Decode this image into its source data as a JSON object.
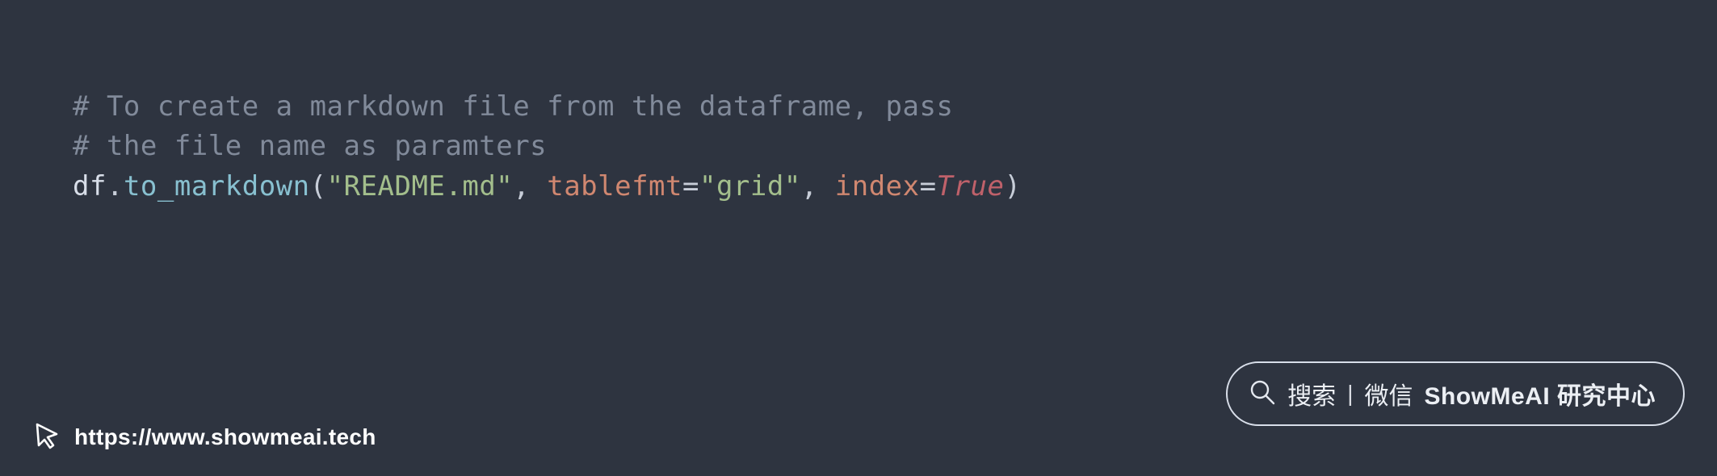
{
  "code": {
    "comment_line_1": "# To create a markdown file from the dataframe, pass",
    "comment_line_2": "# the file name as paramters",
    "obj": "df",
    "dot": ".",
    "method": "to_markdown",
    "open_paren": "(",
    "arg1_string": "\"README.md\"",
    "comma1": ", ",
    "arg2_name": "tablefmt",
    "eq": "=",
    "arg2_value": "\"grid\"",
    "comma2": ", ",
    "arg3_name": "index",
    "arg3_value": "True",
    "close_paren": ")"
  },
  "footer": {
    "url": "https://www.showmeai.tech"
  },
  "search_pill": {
    "search_label": "搜索",
    "separator": "|",
    "wechat_label": "微信",
    "brand": "ShowMeAI 研究中心"
  }
}
